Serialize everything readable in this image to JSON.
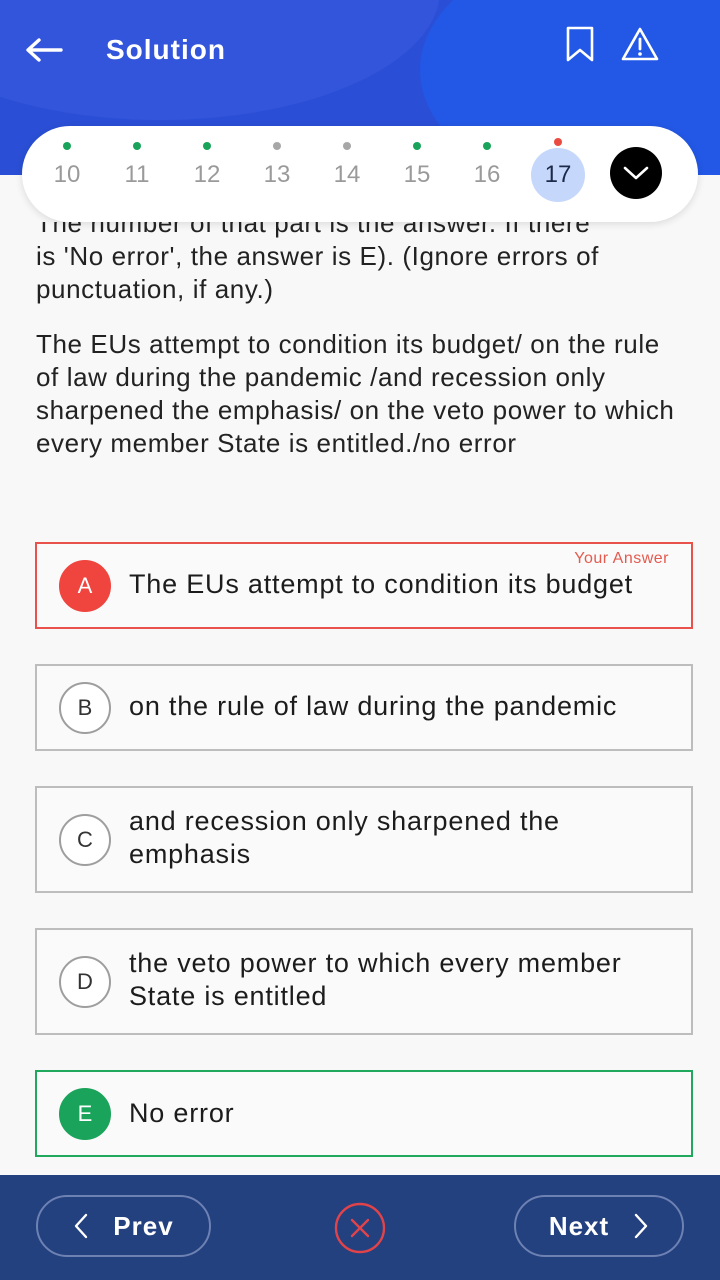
{
  "header": {
    "title": "Solution"
  },
  "navigator": {
    "items": [
      {
        "num": "10",
        "dot": "#1aa35a"
      },
      {
        "num": "11",
        "dot": "#1aa35a"
      },
      {
        "num": "12",
        "dot": "#1aa35a"
      },
      {
        "num": "13",
        "dot": "#a7a7a7"
      },
      {
        "num": "14",
        "dot": "#a7a7a7"
      },
      {
        "num": "15",
        "dot": "#1aa35a"
      },
      {
        "num": "16",
        "dot": "#1aa35a"
      },
      {
        "num": "17",
        "dot": "#ea4a40"
      }
    ],
    "active": "17"
  },
  "passage": {
    "cut_line": "The number of that part is the answer. If there",
    "instruction": "is 'No error', the answer is E). (Ignore errors of punctuation, if any.)",
    "question": "The EUs attempt to condition its budget/ on the rule of law during the pandemic /and recession only sharpened the emphasis/ on the veto power to which every member State is entitled./no error"
  },
  "options": [
    {
      "letter": "A",
      "text": "The EUs attempt to condition its budget",
      "state": "wrong"
    },
    {
      "letter": "B",
      "text": "on the rule of law during the pandemic",
      "state": "normal"
    },
    {
      "letter": "C",
      "text": "and recession only sharpened the emphasis",
      "state": "normal"
    },
    {
      "letter": "D",
      "text": "the veto power to which every member State is entitled",
      "state": "normal"
    },
    {
      "letter": "E",
      "text": "No error",
      "state": "correct"
    }
  ],
  "your_answer_label": "Your Answer",
  "footer": {
    "prev_label": "Prev",
    "next_label": "Next"
  },
  "colors": {
    "header": "#2a4fd6",
    "footer": "#23407f",
    "wrong": "#f0443e",
    "correct": "#1aa35a"
  }
}
